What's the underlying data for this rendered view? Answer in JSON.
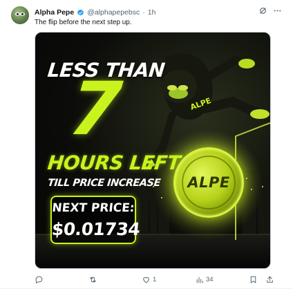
{
  "post": {
    "author_name": "Alpha Pepe",
    "handle": "@alphapepebsc",
    "separator": "·",
    "time": "1h",
    "text": "The flip before the next step up.",
    "verified_color": "#1d9bf0"
  },
  "media": {
    "line1": "LESS THAN",
    "big_number": "7",
    "line2": "HOURS LEFT",
    "line3": "TILL PRICE INCREASE",
    "next_price_label": "NEXT PRICE:",
    "next_price_value": "$0.01734",
    "coin_text": "ALPE",
    "character_label": "ALPE",
    "accent_color": "#c9f31c"
  },
  "actions": {
    "reply_count": "",
    "repost_count": "",
    "like_count": "1",
    "views_count": "34"
  },
  "icons": [
    "grok-icon",
    "more-icon",
    "reply-icon",
    "repost-icon",
    "like-icon",
    "views-icon",
    "bookmark-icon",
    "share-icon"
  ]
}
